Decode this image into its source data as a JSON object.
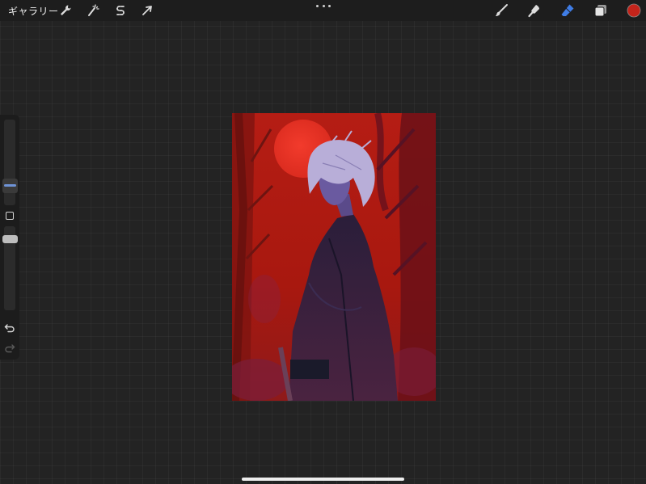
{
  "topbar": {
    "gallery_label": "ギャラリー"
  },
  "icons": {
    "actions": "wrench-icon",
    "adjustments": "magic-wand-icon",
    "selection": "selection-s-icon",
    "transform": "arrow-cursor-icon",
    "more": "ellipsis-icon",
    "brush": "brush-icon",
    "smudge": "smudge-icon",
    "eraser": "eraser-icon",
    "layers": "layers-icon",
    "color": "color-swatch-icon",
    "undo": "undo-icon",
    "redo": "redo-icon"
  },
  "colors": {
    "active_tool": "#3f7de6",
    "current_color": "#c4241b",
    "canvas_red": "#b41d14"
  }
}
